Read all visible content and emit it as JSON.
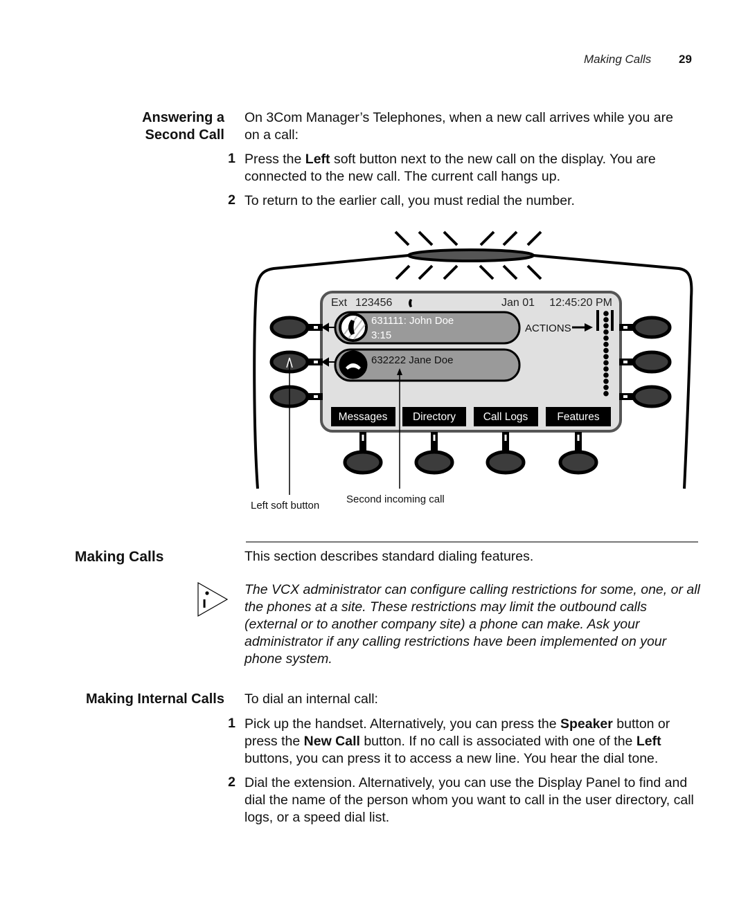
{
  "header": {
    "section_title": "Making Calls",
    "page_number": "29"
  },
  "answering_second_call": {
    "heading_line1": "Answering a",
    "heading_line2": "Second Call",
    "intro_line1": "On 3Com Manager’s Telephones, when a new call arrives while you are",
    "intro_line2": "on a call:",
    "steps": [
      {
        "number": "1",
        "parts": [
          {
            "text": "Press the ",
            "bold": false
          },
          {
            "text": "Left",
            "bold": true
          },
          {
            "text": " soft button next to the new call on the display. You are connected to the new call. The current call hangs up.",
            "bold": false
          }
        ]
      },
      {
        "number": "2",
        "parts": [
          {
            "text": "To return to the earlier call, you must redial the number.",
            "bold": false
          }
        ]
      }
    ]
  },
  "phone_figure": {
    "display": {
      "extension_label": "Ext",
      "extension_number": "123456",
      "date": "Jan 01",
      "time": "12:45:20 PM",
      "actions_label": "ACTIONS",
      "calls": [
        {
          "number_name": "631111: John Doe",
          "duration": "3:15",
          "state": "active"
        },
        {
          "number_name": "632222 Jane Doe",
          "duration": "",
          "state": "incoming"
        }
      ],
      "soft_keys": [
        "Messages",
        "Directory",
        "Call Logs",
        "Features"
      ]
    },
    "callouts": {
      "left_soft_button": "Left soft button",
      "second_incoming_call": "Second incoming call"
    },
    "colors": {
      "screen_bg": "#e0e0e0",
      "call_bubble": "#9a9a9a",
      "button_fill": "#3c3c3c",
      "softkey_bg": "#000000"
    }
  },
  "making_calls": {
    "heading": "Making Calls",
    "intro": "This section describes standard dialing features.",
    "note_icon": "info-icon",
    "note": "The VCX administrator can configure calling restrictions for some, one, or all the phones at a site. These restrictions may limit the outbound calls (external or to another company site) a phone can make. Ask your administrator if any calling restrictions have been implemented on your phone system."
  },
  "making_internal_calls": {
    "heading": "Making Internal Calls",
    "intro": "To dial an internal call:",
    "steps": [
      {
        "number": "1",
        "parts": [
          {
            "text": "Pick up the handset. Alternatively, you can press the ",
            "bold": false
          },
          {
            "text": "Speaker",
            "bold": true
          },
          {
            "text": " button or press the ",
            "bold": false
          },
          {
            "text": "New Call",
            "bold": true
          },
          {
            "text": " button. If no call is associated with one of the ",
            "bold": false
          },
          {
            "text": "Left",
            "bold": true
          },
          {
            "text": " buttons, you can press it to access a new line. You hear the dial tone.",
            "bold": false
          }
        ]
      },
      {
        "number": "2",
        "parts": [
          {
            "text": "Dial the extension. Alternatively, you can use the Display Panel to find and dial the name of the person whom you want to call in the user directory, call logs, or a speed dial list.",
            "bold": false
          }
        ]
      }
    ]
  }
}
